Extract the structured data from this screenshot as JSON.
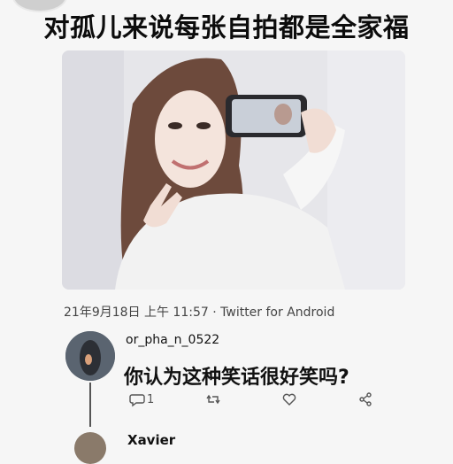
{
  "post": {
    "headline": "对孤儿来说每张自拍都是全家福",
    "meta": "21年9月18日 上午 11:57 · Twitter for Android"
  },
  "reply": {
    "username": "or_pha_n_0522",
    "text": "你认为这种笑话很好笑吗?",
    "reply_count": "1",
    "retweet_count": "",
    "like_count": ""
  },
  "next_reply": {
    "username": "Xavier"
  },
  "icons": {
    "reply": "comment-icon",
    "retweet": "retweet-icon",
    "like": "heart-icon",
    "share": "share-icon"
  }
}
